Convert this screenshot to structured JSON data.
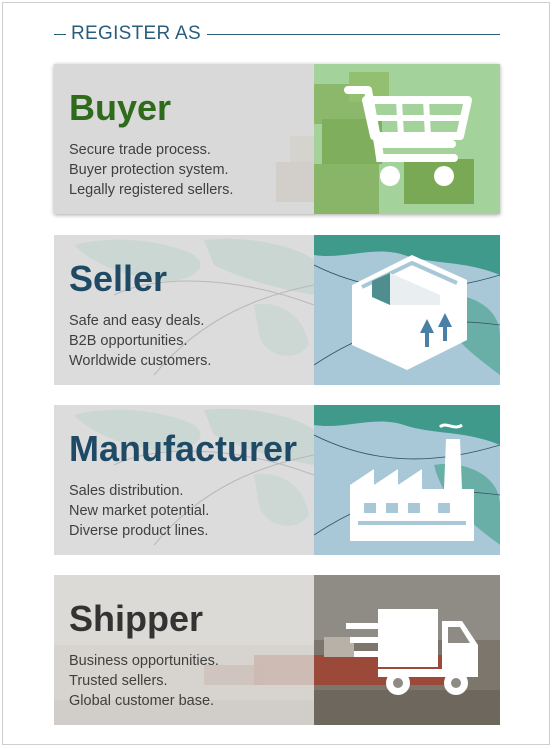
{
  "header": {
    "title": "REGISTER AS"
  },
  "cards": {
    "buyer": {
      "name": "Buyer",
      "lines": [
        "Secure trade process.",
        "Buyer protection system.",
        "Legally registered sellers."
      ],
      "icon": "shopping-cart-icon",
      "accent": "#2e6b1b",
      "panel_color": "#a3d39a"
    },
    "seller": {
      "name": "Seller",
      "lines": [
        "Safe and easy deals.",
        "B2B opportunities.",
        "Worldwide customers."
      ],
      "icon": "package-box-icon",
      "accent": "#1e4a66",
      "panel_color": "#a8c8d8"
    },
    "manufacturer": {
      "name": "Manufacturer",
      "lines": [
        "Sales distribution.",
        "New market potential.",
        "Diverse product lines."
      ],
      "icon": "factory-icon",
      "accent": "#1e4a66",
      "panel_color": "#a8c8d8"
    },
    "shipper": {
      "name": "Shipper",
      "lines": [
        "Business opportunities.",
        "Trusted sellers.",
        "Global customer base."
      ],
      "icon": "delivery-truck-icon",
      "accent": "#333333",
      "panel_color": "#8e8b84"
    }
  }
}
